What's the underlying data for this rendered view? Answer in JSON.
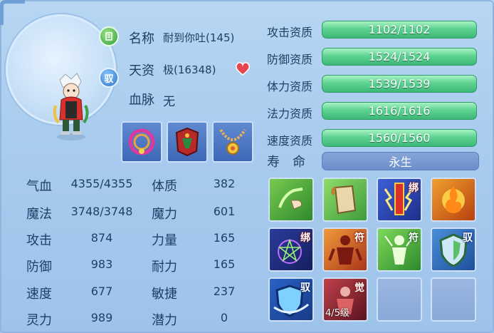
{
  "character": {
    "name_label": "名称",
    "name_value": "耐到你吐(145)",
    "talent_label": "天资",
    "talent_value": "极(16348)",
    "bloodline_label": "血脉",
    "bloodline_value": "无",
    "badge_top_icon": "growth-icon",
    "badge_mid_text": "驭"
  },
  "equipment": [
    {
      "name": "collar-equipment"
    },
    {
      "name": "armor-equipment"
    },
    {
      "name": "necklace-equipment"
    }
  ],
  "stats": [
    {
      "label": "气血",
      "value": "4355/4355",
      "label2": "体质",
      "value2": "382"
    },
    {
      "label": "魔法",
      "value": "3748/3748",
      "label2": "魔力",
      "value2": "601"
    },
    {
      "label": "攻击",
      "value": "874",
      "label2": "力量",
      "value2": "165"
    },
    {
      "label": "防御",
      "value": "983",
      "label2": "耐力",
      "value2": "165"
    },
    {
      "label": "速度",
      "value": "677",
      "label2": "敏捷",
      "value2": "237"
    },
    {
      "label": "灵力",
      "value": "989",
      "label2": "潜力",
      "value2": "0"
    }
  ],
  "aptitudes": [
    {
      "label": "攻击资质",
      "value": "1102/1102",
      "fill": 1.0
    },
    {
      "label": "防御资质",
      "value": "1524/1524",
      "fill": 1.0
    },
    {
      "label": "体力资质",
      "value": "1539/1539",
      "fill": 1.0
    },
    {
      "label": "法力资质",
      "value": "1616/1616",
      "fill": 1.0
    },
    {
      "label": "速度资质",
      "value": "1560/1560",
      "fill": 1.0
    }
  ],
  "lifespan": {
    "label": "寿命",
    "value": "永生"
  },
  "skills": [
    {
      "icon": "hand-gesture-icon",
      "tag": ""
    },
    {
      "icon": "scroll-icon",
      "tag": ""
    },
    {
      "icon": "binding-lightning-icon",
      "tag": "绑"
    },
    {
      "icon": "fire-burst-icon",
      "tag": ""
    },
    {
      "icon": "curse-pentagram-icon",
      "tag": "绑"
    },
    {
      "icon": "fire-figure-icon",
      "tag": "符"
    },
    {
      "icon": "green-figure-icon",
      "tag": "符"
    },
    {
      "icon": "shield-icon",
      "tag": "驭"
    },
    {
      "icon": "blue-shield-icon",
      "tag": "驭"
    },
    {
      "icon": "awaken-icon",
      "tag": "觉",
      "level": "4/5级"
    },
    {
      "icon": "empty-slot-icon",
      "tag": ""
    },
    {
      "icon": "empty-slot-icon",
      "tag": ""
    }
  ],
  "colors": {
    "aptitude_bar": "#5ed292",
    "lifespan_bar": "#6b8ecc",
    "text": "#1f3f66"
  }
}
